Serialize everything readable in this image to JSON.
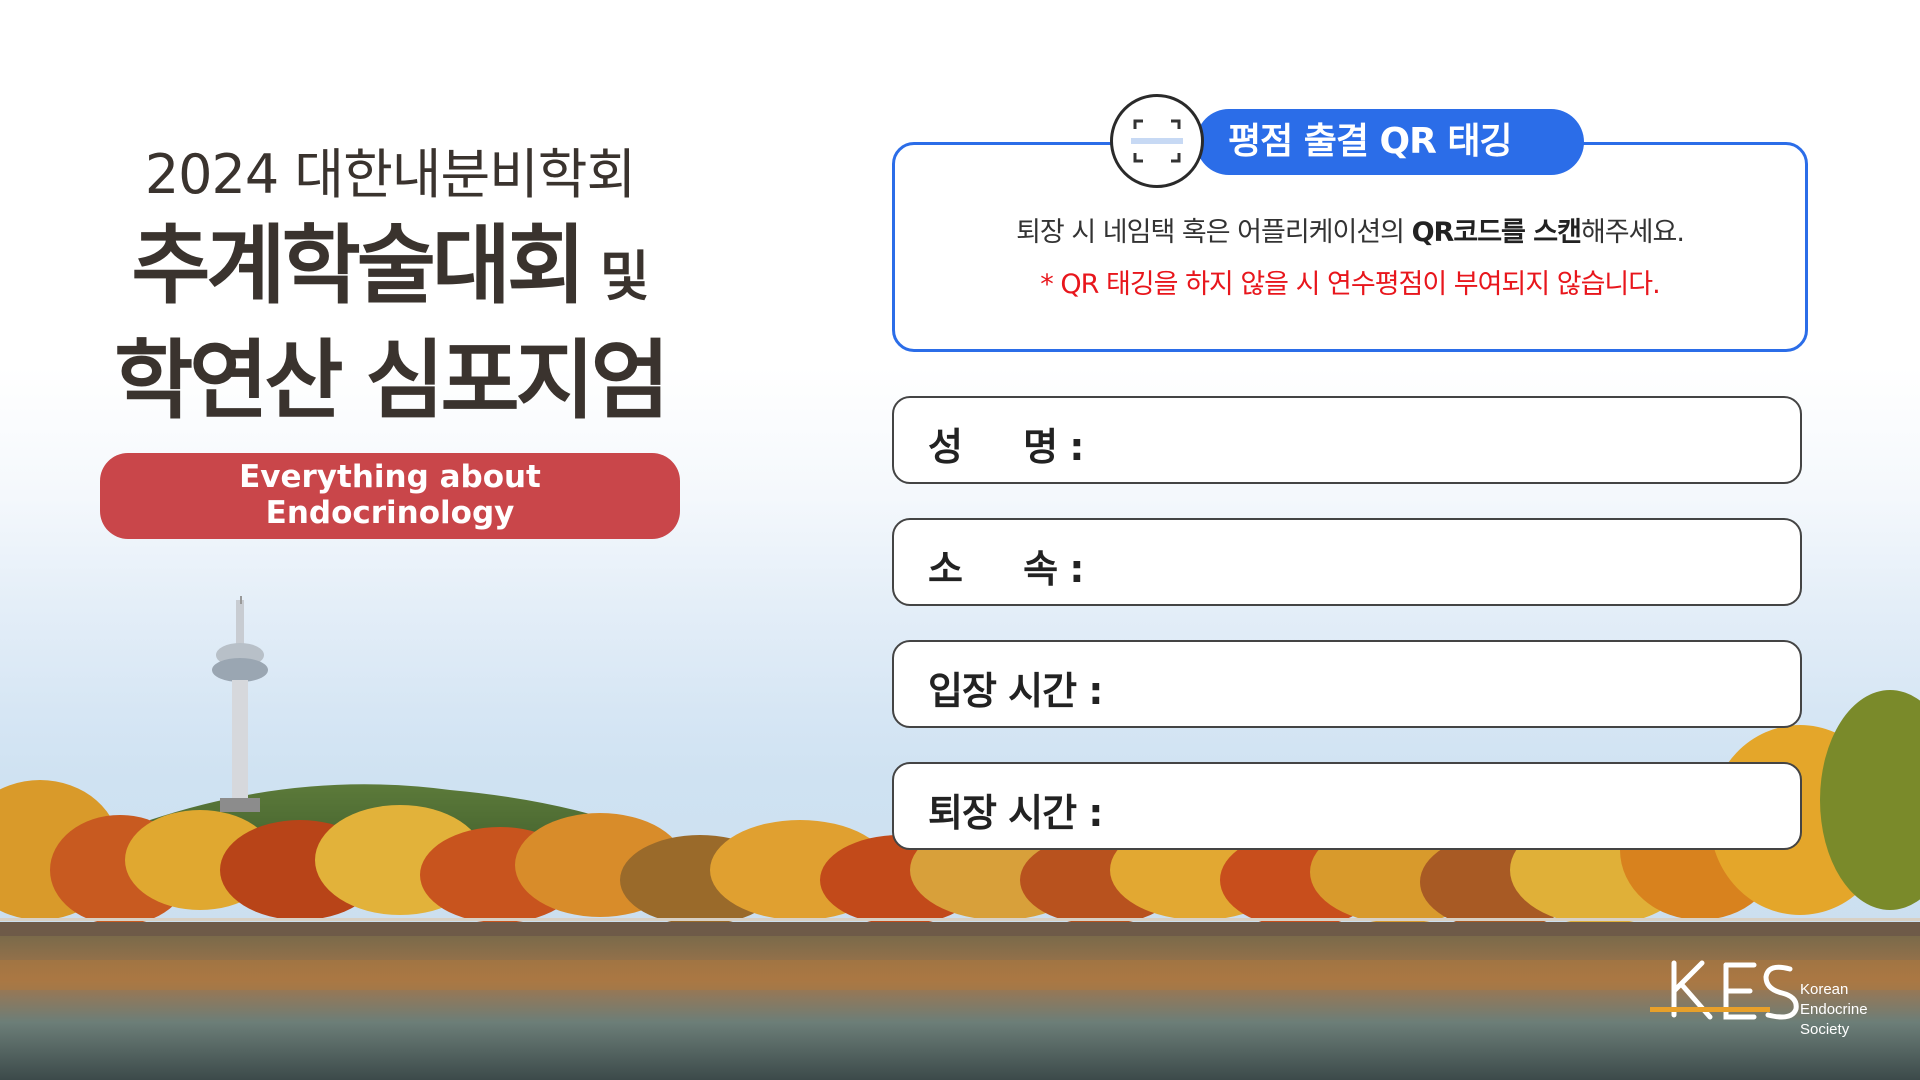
{
  "title": {
    "line1": "2024 대한내분비학회",
    "line2_main": "추계학술대회",
    "line2_suffix": " 및",
    "line3": "학연산 심포지엄",
    "subtitle": "Everything about Endocrinology"
  },
  "qr": {
    "tab_label": "평점 출결 QR 태깅",
    "instruction_pre": "퇴장 시 네임택 혹은 어플리케이션의 ",
    "instruction_bold1": "QR코드를 스캔",
    "instruction_post": "해주세요.",
    "warning": "* QR 태깅을 하지 않을 시 연수평점이 부여되지 않습니다.",
    "icon": "qr-scan-icon"
  },
  "fields": [
    {
      "label": "성     명 :"
    },
    {
      "label": "소     속 :"
    },
    {
      "label": "입장 시간 :"
    },
    {
      "label": "퇴장 시간 :"
    }
  ],
  "logo": {
    "mark": "KES",
    "text": [
      "Korean",
      "Endocrine",
      "Society"
    ]
  },
  "colors": {
    "accent_blue": "#2b6de8",
    "pill_red": "#c9464a",
    "warning_red": "#e8161c",
    "title_brown": "#3a332e"
  }
}
